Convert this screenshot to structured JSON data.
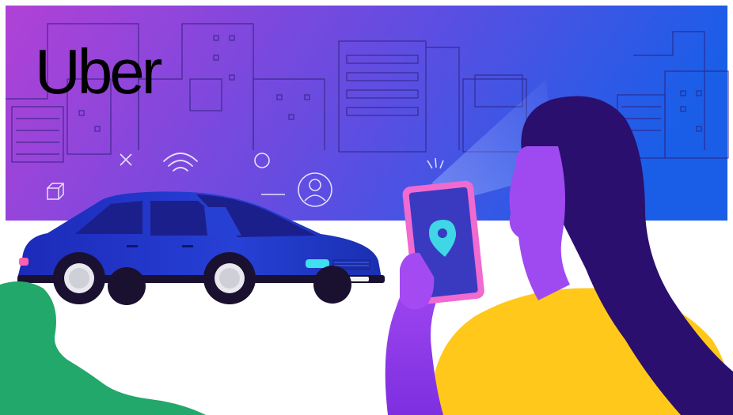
{
  "brand": {
    "logo_text": "Uber",
    "logo_color": "#000000"
  },
  "colors": {
    "sky_left": "#b141d6",
    "sky_mid": "#6a4be0",
    "sky_right": "#1a5ee8",
    "car_body": "#2336c9",
    "car_roof": "#1b1f8c",
    "headlight": "#3fe0f0",
    "taillight": "#ff5fb0",
    "phone_frame": "#f06ad0",
    "phone_screen": "#3a3ac0",
    "pin": "#3fd6e6",
    "hair": "#2a0f6e",
    "skin": "#9f4af0",
    "shirt": "#ffc81a",
    "bush": "#22a86a",
    "ground": "#ffffff"
  },
  "icons": [
    "close-icon",
    "wifi-icon",
    "circle-icon",
    "user-icon",
    "cube-icon",
    "location-pin-icon"
  ]
}
